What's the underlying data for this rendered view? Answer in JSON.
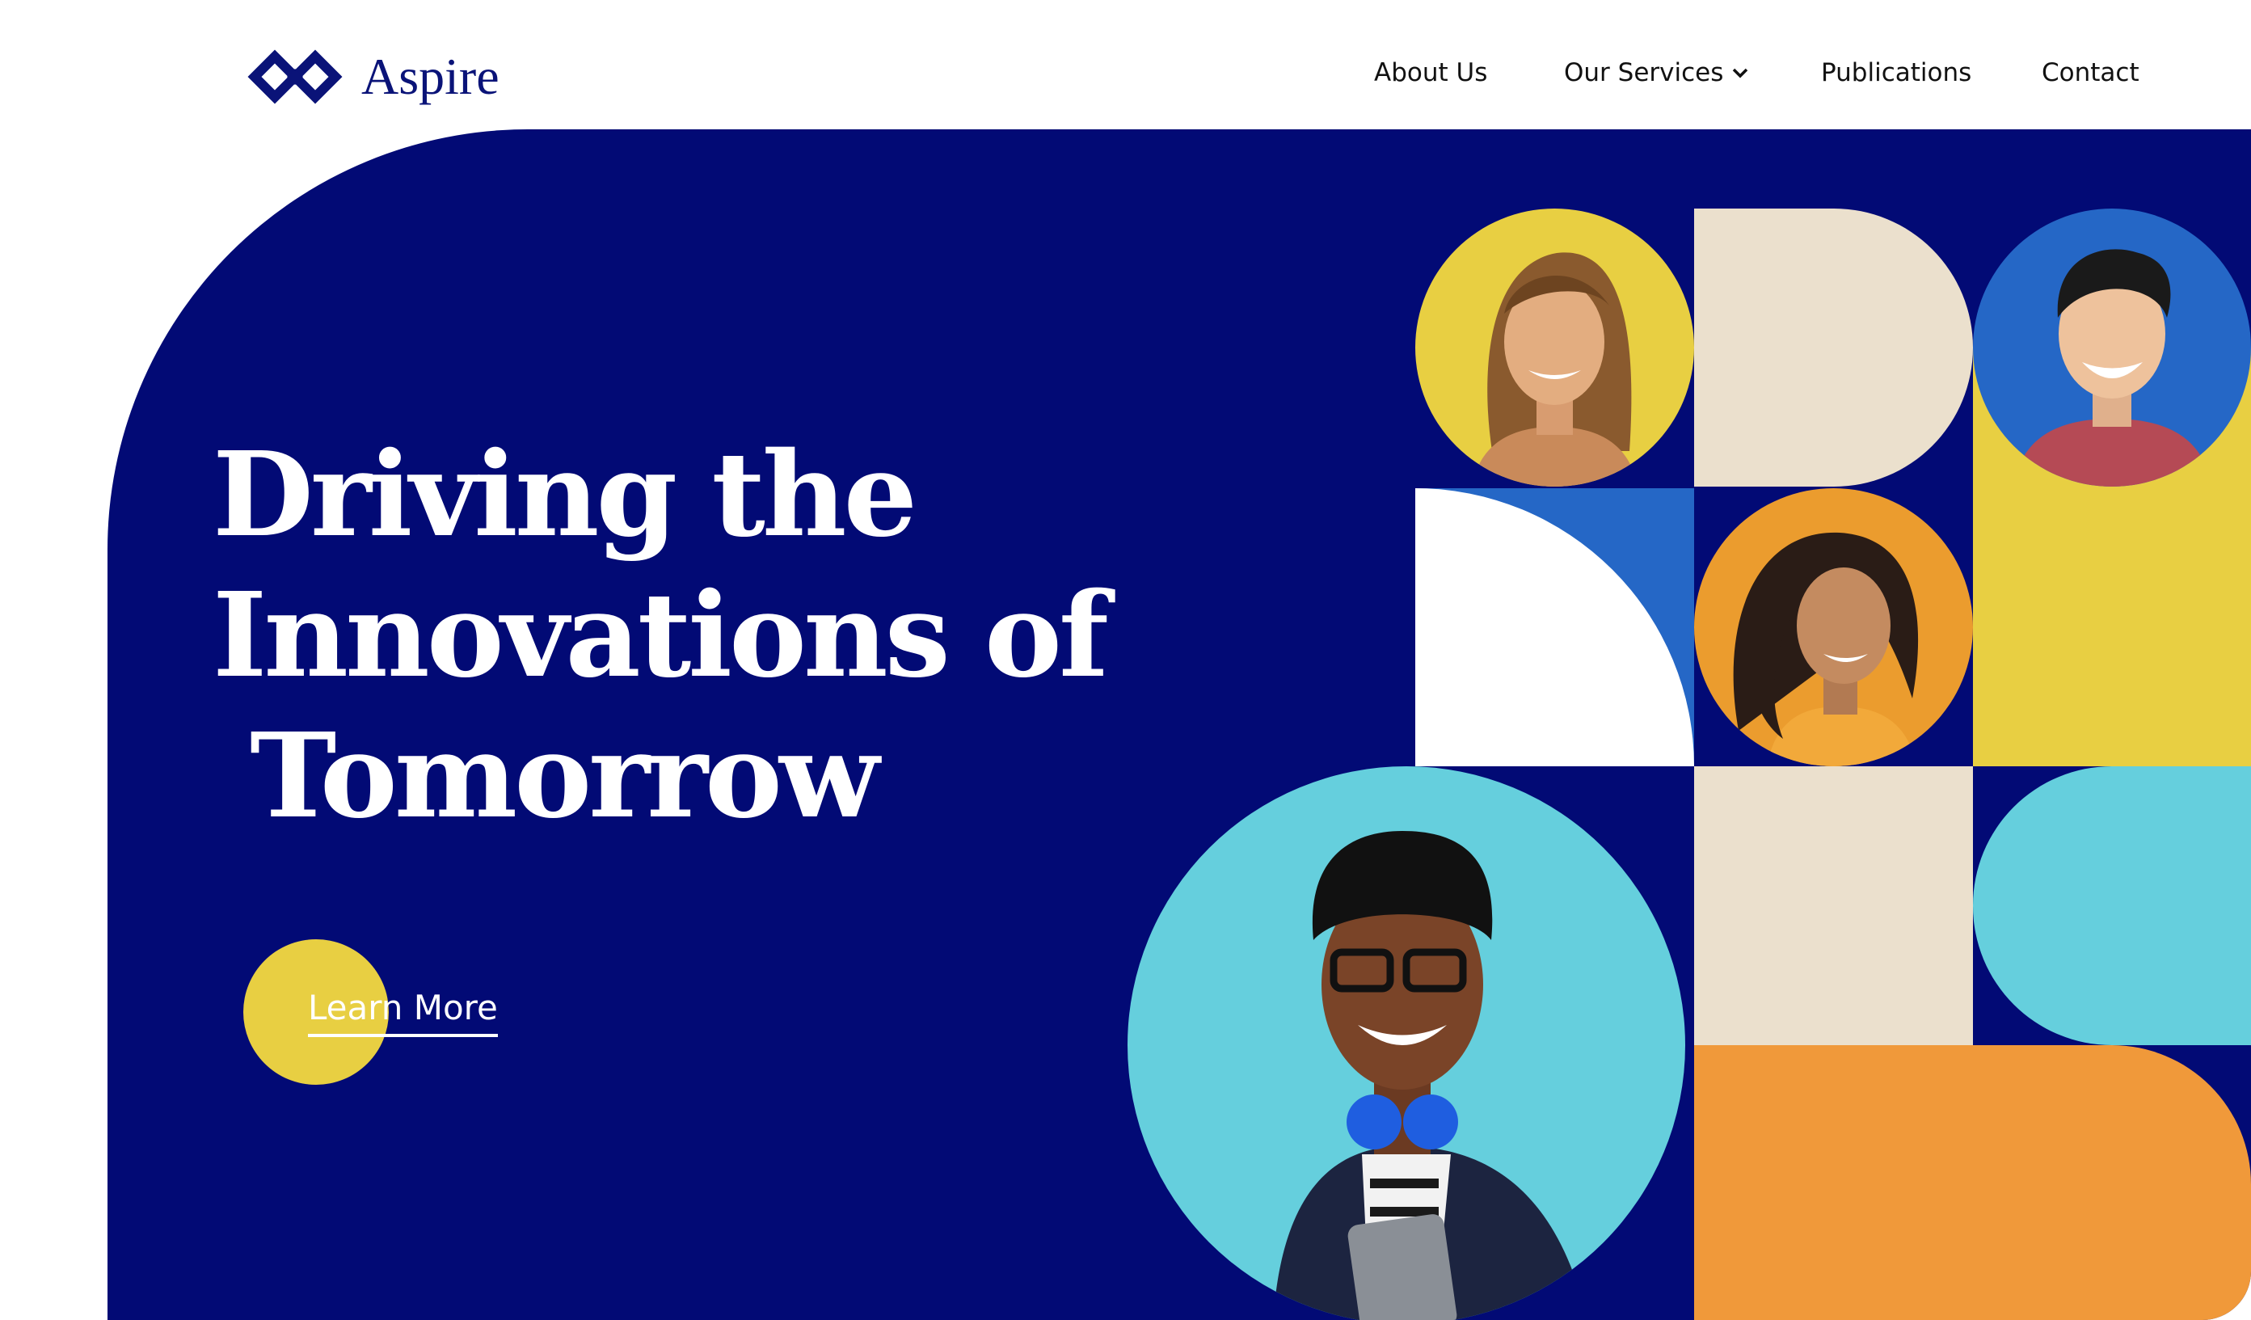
{
  "brand": {
    "name": "Aspire",
    "logo_icon": "diamond-chain-logo-icon",
    "color": "#0a1378"
  },
  "nav": {
    "about": "About Us",
    "services": "Our Services",
    "services_icon": "chevron-down-icon",
    "publications": "Publications",
    "contact": "Contact"
  },
  "hero": {
    "headline_lines": [
      "Driving the",
      "Innovations of",
      " Tomorrow"
    ],
    "cta_label": "Learn More"
  },
  "colors": {
    "navy": "#020a75",
    "yellow": "#e8cf42",
    "beige": "#ebe0cd",
    "royal_blue": "#2567c6",
    "orange_circle": "#eb9c2e",
    "cyan": "#65cfdd",
    "orange_block": "#f0993a",
    "white": "#ffffff"
  }
}
